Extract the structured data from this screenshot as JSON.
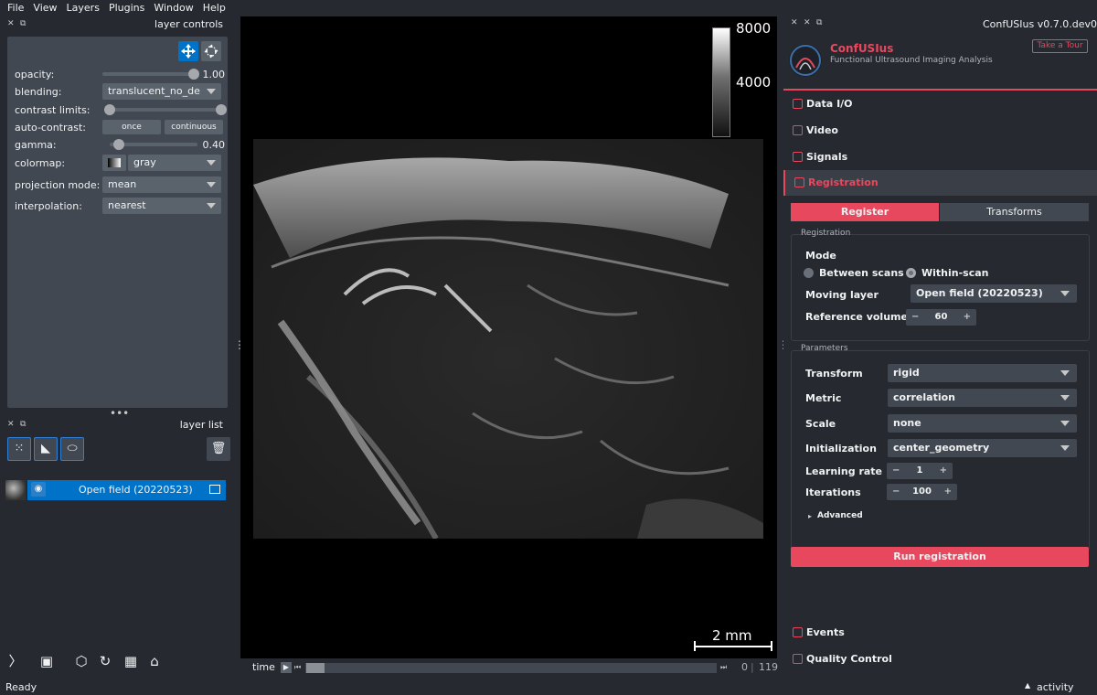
{
  "menu": [
    "File",
    "View",
    "Layers",
    "Plugins",
    "Window",
    "Help"
  ],
  "layer_controls": {
    "title": "layer controls",
    "opacity_label": "opacity:",
    "opacity_value": "1.00",
    "opacity_level": 1.0,
    "blending_label": "blending:",
    "blending_value": "translucent_no_de",
    "contrast_label": "contrast limits:",
    "autocontrast_label": "auto-contrast:",
    "once_label": "once",
    "continuous_label": "continuous",
    "gamma_label": "gamma:",
    "gamma_value": "0.40",
    "colormap_label": "colormap:",
    "colormap_value": "gray",
    "projection_label": "projection mode:",
    "projection_value": "mean",
    "interpolation_label": "interpolation:",
    "interpolation_value": "nearest"
  },
  "layer_list": {
    "title": "layer list",
    "layer_name": "Open field (20220523)"
  },
  "viewer": {
    "colorbar_max": "8000",
    "colorbar_mid": "4000",
    "scale_label": "2 mm",
    "time_label": "time",
    "frame_current": "0",
    "frame_total": "119"
  },
  "plugin": {
    "header": "ConfUSIus v0.7.0.dev0",
    "name": "ConfUSIus",
    "subtitle": "Functional Ultrasound Imaging Analysis",
    "tour_label": "Take a Tour",
    "nav": [
      "Data I/O",
      "Video",
      "Signals",
      "Registration"
    ],
    "tab_register": "Register",
    "tab_transforms": "Transforms",
    "registration_group": "Registration",
    "mode_label": "Mode",
    "mode_between": "Between scans",
    "mode_within": "Within-scan",
    "moving_layer_label": "Moving layer",
    "moving_layer_value": "Open field (20220523)",
    "reference_volume_label": "Reference volume",
    "reference_volume_value": "60",
    "parameters_group": "Parameters",
    "transform_label": "Transform",
    "transform_value": "rigid",
    "metric_label": "Metric",
    "metric_value": "correlation",
    "scale_label": "Scale",
    "scale_value": "none",
    "init_label": "Initialization",
    "init_value": "center_geometry",
    "lr_label": "Learning rate",
    "lr_value": "1",
    "iter_label": "Iterations",
    "iter_value": "100",
    "advanced_label": "Advanced",
    "run_label": "Run registration",
    "nav_bottom": [
      "Events",
      "Quality Control"
    ]
  },
  "status": {
    "left": "Ready",
    "right": "activity"
  },
  "colors": {
    "accent": "#e8485e",
    "selection": "#0072c8",
    "panel": "#414851",
    "background": "#262930"
  }
}
